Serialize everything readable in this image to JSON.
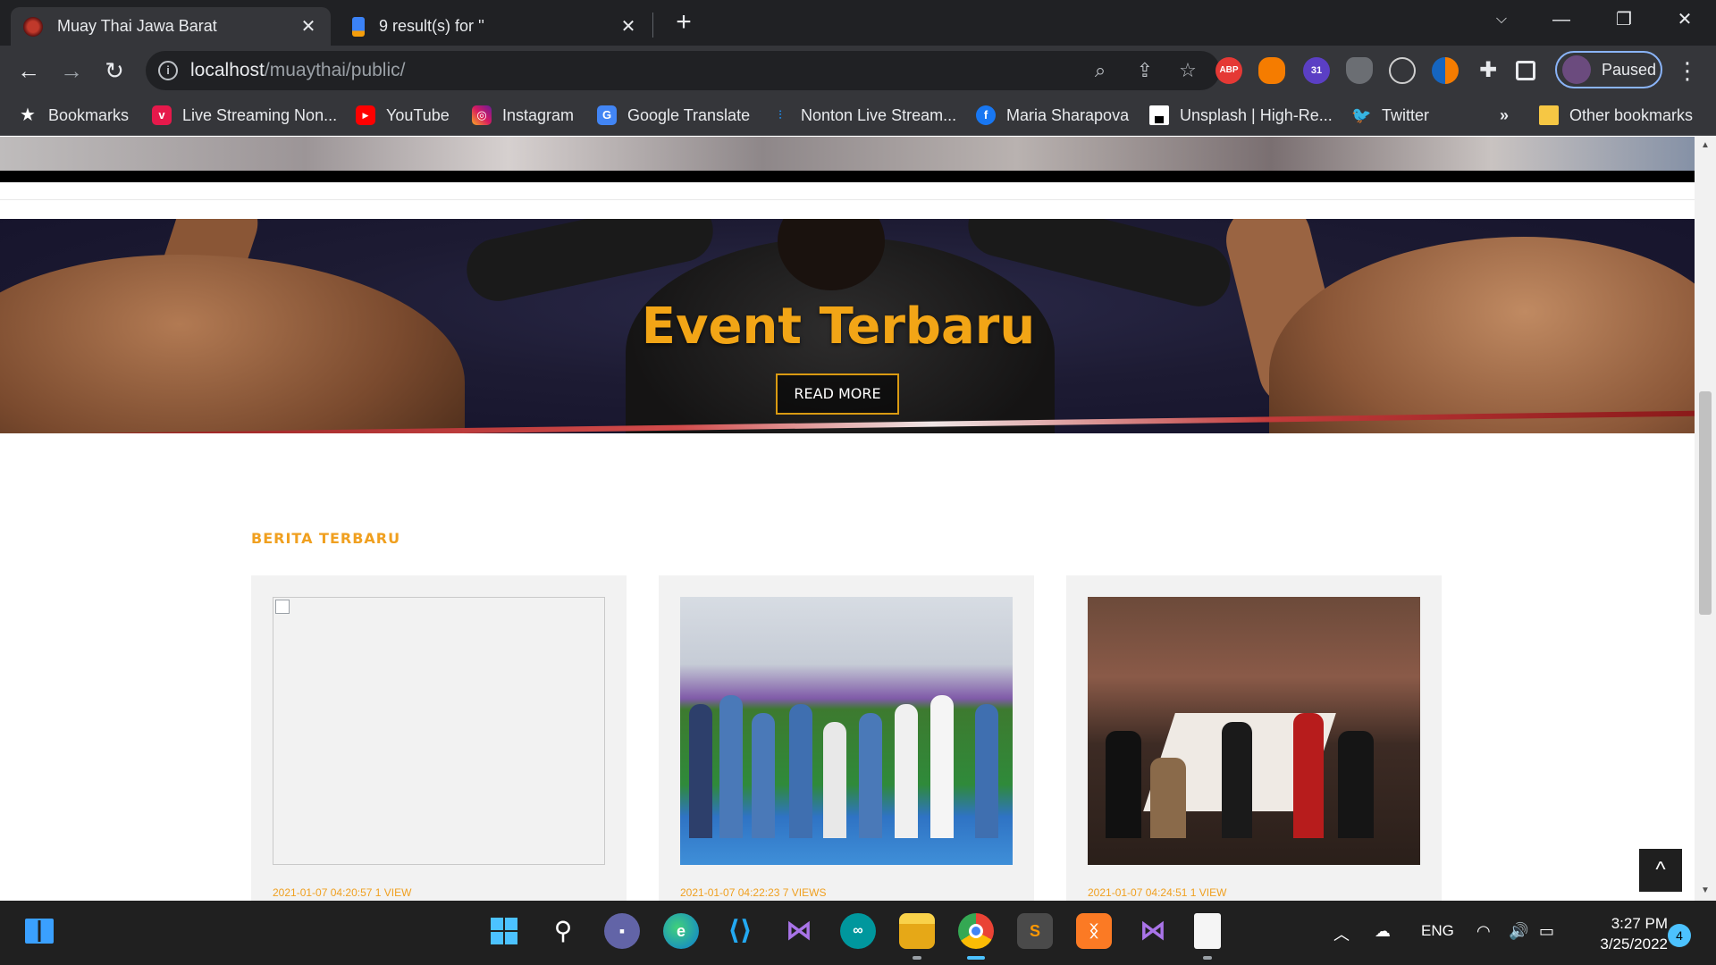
{
  "browser": {
    "tabs": [
      {
        "title": "Muay Thai Jawa Barat",
        "active": true
      },
      {
        "title": "9 result(s) for ''",
        "active": false
      }
    ],
    "url_host": "localhost",
    "url_path": "/muaythai/public/",
    "profile_label": "Paused",
    "extensions": [
      "ABP",
      "31"
    ]
  },
  "bookmarks": [
    {
      "label": "Bookmarks",
      "icon": "star-icon"
    },
    {
      "label": "Live Streaming Non...",
      "icon": "vidio-icon"
    },
    {
      "label": "YouTube",
      "icon": "youtube-icon"
    },
    {
      "label": "Instagram",
      "icon": "instagram-icon"
    },
    {
      "label": "Google Translate",
      "icon": "google-translate-icon"
    },
    {
      "label": "Nonton Live Stream...",
      "icon": "stream-icon"
    },
    {
      "label": "Maria Sharapova",
      "icon": "facebook-icon"
    },
    {
      "label": "Unsplash | High-Re...",
      "icon": "unsplash-icon"
    },
    {
      "label": "Twitter",
      "icon": "twitter-icon"
    }
  ],
  "bookmarks_overflow": "»",
  "other_bookmarks": "Other bookmarks",
  "page": {
    "hero_title": "Event Terbaru",
    "hero_button": "READ MORE",
    "section_label": "BERITA TERBARU",
    "cards": [
      {
        "image": "broken",
        "meta": "2021-01-07 04:20:57   1 VIEW"
      },
      {
        "image": "stadium-group",
        "meta": "2021-01-07 04:22:23   7 VIEWS"
      },
      {
        "image": "meeting-room",
        "meta": "2021-01-07 04:24:51   1 VIEW"
      }
    ],
    "scroll_top": "^"
  },
  "taskbar": {
    "apps": [
      "windows-start",
      "search",
      "teams-chat",
      "edge",
      "vscode",
      "visual-studio",
      "arduino",
      "file-explorer",
      "chrome",
      "sublime-text",
      "xampp",
      "visual-studio-2",
      "notepad"
    ],
    "tray_lang": "ENG",
    "time": "3:27 PM",
    "date": "3/25/2022",
    "notifications": "4"
  },
  "colors": {
    "accent": "#f2a516",
    "chrome_dark": "#202124",
    "chrome_toolbar": "#35363a"
  }
}
